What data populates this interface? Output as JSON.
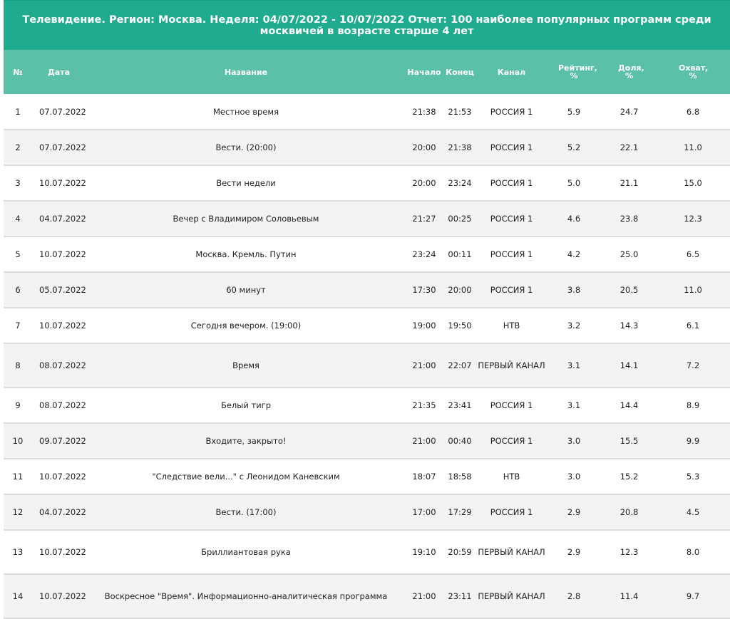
{
  "report": {
    "title": "Телевидение. Регион: Москва. Неделя: 04/07/2022 - 10/07/2022 Отчет: 100 наиболее популярных программ среди москвичей в возрасте старше 4 лет"
  },
  "table": {
    "headers": {
      "num": "№",
      "date": "Дата",
      "name": "Название",
      "start": "Начало",
      "end": "Конец",
      "channel": "Канал",
      "rating": "Рейтинг, %",
      "share": "Доля, %",
      "reach": "Охват, %"
    },
    "rows": [
      {
        "num": "1",
        "date": "07.07.2022",
        "name": "Местное время",
        "start": "21:38",
        "end": "21:53",
        "channel": "РОССИЯ 1",
        "rating": "5.9",
        "share": "24.7",
        "reach": "6.8"
      },
      {
        "num": "2",
        "date": "07.07.2022",
        "name": "Вести. (20:00)",
        "start": "20:00",
        "end": "21:38",
        "channel": "РОССИЯ 1",
        "rating": "5.2",
        "share": "22.1",
        "reach": "11.0"
      },
      {
        "num": "3",
        "date": "10.07.2022",
        "name": "Вести недели",
        "start": "20:00",
        "end": "23:24",
        "channel": "РОССИЯ 1",
        "rating": "5.0",
        "share": "21.1",
        "reach": "15.0"
      },
      {
        "num": "4",
        "date": "04.07.2022",
        "name": "Вечер с Владимиром Соловьевым",
        "start": "21:27",
        "end": "00:25",
        "channel": "РОССИЯ 1",
        "rating": "4.6",
        "share": "23.8",
        "reach": "12.3"
      },
      {
        "num": "5",
        "date": "10.07.2022",
        "name": "Москва. Кремль. Путин",
        "start": "23:24",
        "end": "00:11",
        "channel": "РОССИЯ 1",
        "rating": "4.2",
        "share": "25.0",
        "reach": "6.5"
      },
      {
        "num": "6",
        "date": "05.07.2022",
        "name": "60 минут",
        "start": "17:30",
        "end": "20:00",
        "channel": "РОССИЯ 1",
        "rating": "3.8",
        "share": "20.5",
        "reach": "11.0"
      },
      {
        "num": "7",
        "date": "10.07.2022",
        "name": "Сегодня вечером. (19:00)",
        "start": "19:00",
        "end": "19:50",
        "channel": "НТВ",
        "rating": "3.2",
        "share": "14.3",
        "reach": "6.1"
      },
      {
        "num": "8",
        "date": "08.07.2022",
        "name": "Время",
        "start": "21:00",
        "end": "22:07",
        "channel": "ПЕРВЫЙ КАНАЛ",
        "rating": "3.1",
        "share": "14.1",
        "reach": "7.2"
      },
      {
        "num": "9",
        "date": "08.07.2022",
        "name": "Белый тигр",
        "start": "21:35",
        "end": "23:41",
        "channel": "РОССИЯ 1",
        "rating": "3.1",
        "share": "14.4",
        "reach": "8.9"
      },
      {
        "num": "10",
        "date": "09.07.2022",
        "name": "Входите, закрыто!",
        "start": "21:00",
        "end": "00:40",
        "channel": "РОССИЯ 1",
        "rating": "3.0",
        "share": "15.5",
        "reach": "9.9"
      },
      {
        "num": "11",
        "date": "10.07.2022",
        "name": "\"Следствие вели...\" с Леонидом Каневским",
        "start": "18:07",
        "end": "18:58",
        "channel": "НТВ",
        "rating": "3.0",
        "share": "15.2",
        "reach": "5.3"
      },
      {
        "num": "12",
        "date": "04.07.2022",
        "name": "Вести. (17:00)",
        "start": "17:00",
        "end": "17:29",
        "channel": "РОССИЯ 1",
        "rating": "2.9",
        "share": "20.8",
        "reach": "4.5"
      },
      {
        "num": "13",
        "date": "10.07.2022",
        "name": "Бриллиантовая рука",
        "start": "19:10",
        "end": "20:59",
        "channel": "ПЕРВЫЙ КАНАЛ",
        "rating": "2.9",
        "share": "12.3",
        "reach": "8.0"
      },
      {
        "num": "14",
        "date": "10.07.2022",
        "name": "Воскресное \"Время\". Информационно-аналитическая программа",
        "start": "21:00",
        "end": "23:11",
        "channel": "ПЕРВЫЙ КАНАЛ",
        "rating": "2.8",
        "share": "11.4",
        "reach": "9.7"
      }
    ]
  }
}
